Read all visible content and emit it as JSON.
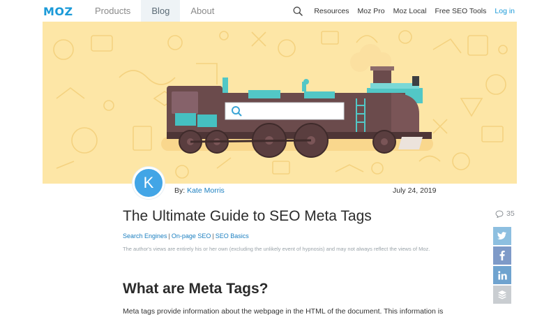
{
  "header": {
    "logo": "MOZ",
    "tabs": [
      {
        "label": "Products",
        "active": false
      },
      {
        "label": "Blog",
        "active": true
      },
      {
        "label": "About",
        "active": false
      }
    ],
    "right_links": [
      "Resources",
      "Moz Pro",
      "Moz Local",
      "Free SEO Tools"
    ],
    "login": "Log in",
    "search_icon": "search-icon"
  },
  "hero": {
    "illustration": "train-with-search-bar",
    "background_color": "#fde6a6"
  },
  "author": {
    "initial": "K",
    "by_label": "By: ",
    "name": "Kate Morris",
    "date": "July 24, 2019"
  },
  "article": {
    "title": "The Ultimate Guide to SEO Meta Tags",
    "categories": [
      "Search Engines",
      "On-page SEO",
      "SEO Basics"
    ],
    "category_separator": "|",
    "disclaimer": "The author's views are entirely his or her own (excluding the unlikely event of hypnosis) and may not always reflect the views of Moz.",
    "section_heading": "What are Meta Tags?",
    "body": "Meta tags provide information about the webpage in the HTML of the document. This information is"
  },
  "share": {
    "comment_count": "35",
    "buttons": [
      "twitter",
      "facebook",
      "linkedin",
      "buffer"
    ]
  },
  "colors": {
    "brand": "#1b9ad8",
    "link": "#1b7fc0",
    "avatar": "#42a5e6",
    "active_tab_bg": "#eef3f6"
  }
}
